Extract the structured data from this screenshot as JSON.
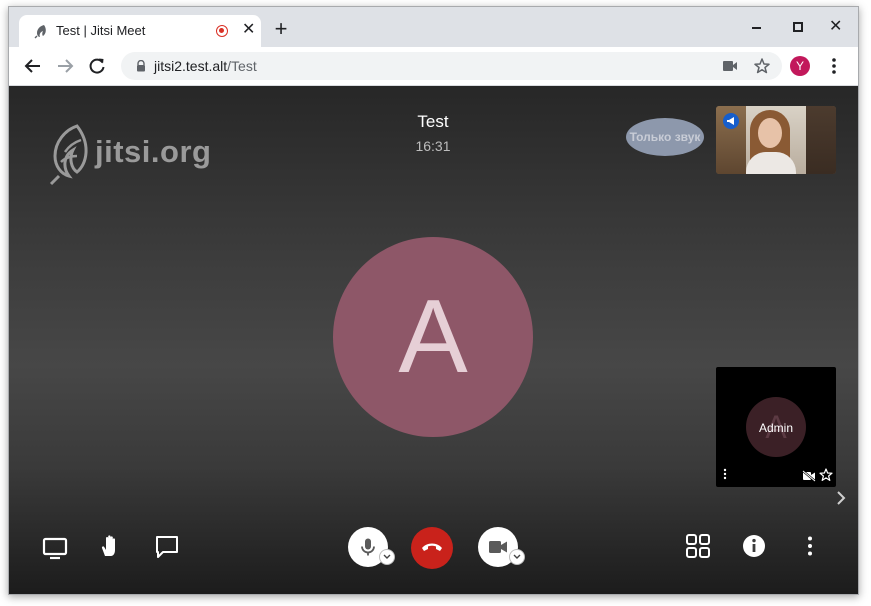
{
  "browser": {
    "tab": {
      "title": "Test | Jitsi Meet",
      "close_symbol": "✕"
    },
    "new_tab_symbol": "+",
    "window_controls": {
      "close_symbol": "✕"
    },
    "address": {
      "host": "jitsi2.test.alt",
      "path": "/Test"
    },
    "profile_initial": "Y"
  },
  "meeting": {
    "watermark": "jitsi.org",
    "conference_name": "Test",
    "duration": "16:31",
    "audio_only_label": "Только звук",
    "dominant_speaker_initial": "A",
    "admin_tile": {
      "initial": "A",
      "display_name": "Admin"
    }
  },
  "colors": {
    "avatar": "#8e5768",
    "hangup": "#c9221b",
    "profile": "#c2185b",
    "speaker_badge": "#165ecc"
  },
  "icons": {
    "left_toolbar": [
      "screen-share-icon",
      "raise-hand-icon",
      "chat-icon"
    ],
    "center_toolbar": [
      "microphone-icon",
      "hangup-icon",
      "camera-icon"
    ],
    "right_toolbar": [
      "tile-view-icon",
      "info-icon",
      "more-options-icon"
    ]
  }
}
